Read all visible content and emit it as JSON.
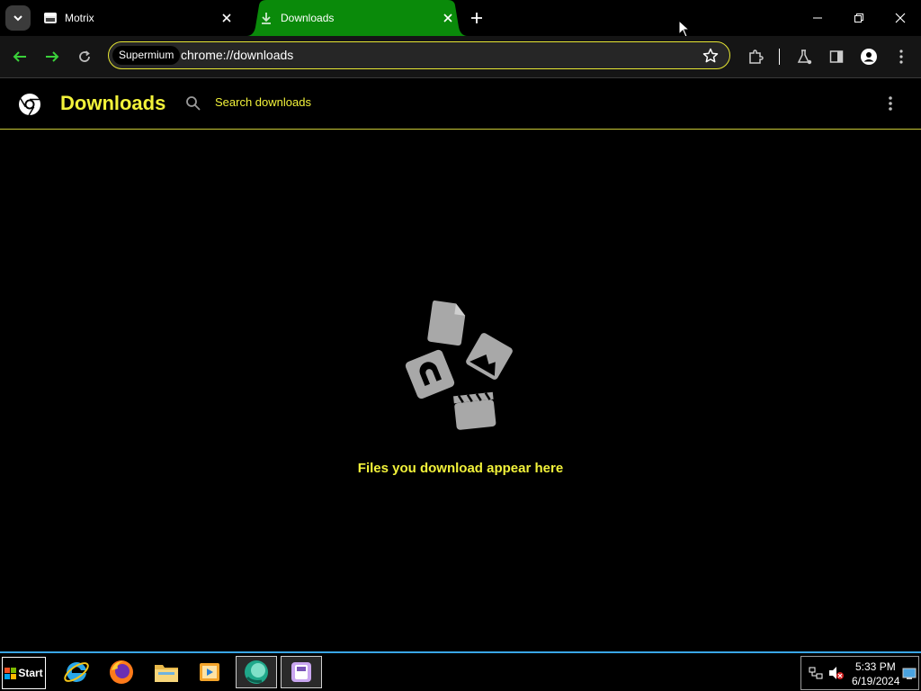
{
  "tabs": [
    {
      "title": "Motrix",
      "favicon": "window-icon",
      "active": false
    },
    {
      "title": "Downloads",
      "favicon": "download-icon",
      "active": true
    }
  ],
  "toolbar": {
    "chip_label": "Supermium",
    "url": "chrome://downloads"
  },
  "downloads_page": {
    "title": "Downloads",
    "search_placeholder": "Search downloads",
    "empty_message": "Files you download appear here"
  },
  "taskbar": {
    "start_label": "Start",
    "apps": [
      "internet-explorer-icon",
      "firefox-icon",
      "file-explorer-icon",
      "media-player-icon",
      "supermium-icon",
      "floppy-app-icon"
    ],
    "clock_time": "5:33 PM",
    "clock_date": "6/19/2024"
  },
  "colors": {
    "accent_yellow": "#f2f23a",
    "active_tab_green": "#0a8a0a",
    "nav_green": "#3ad13a",
    "taskbar_border": "#39a6e6"
  }
}
